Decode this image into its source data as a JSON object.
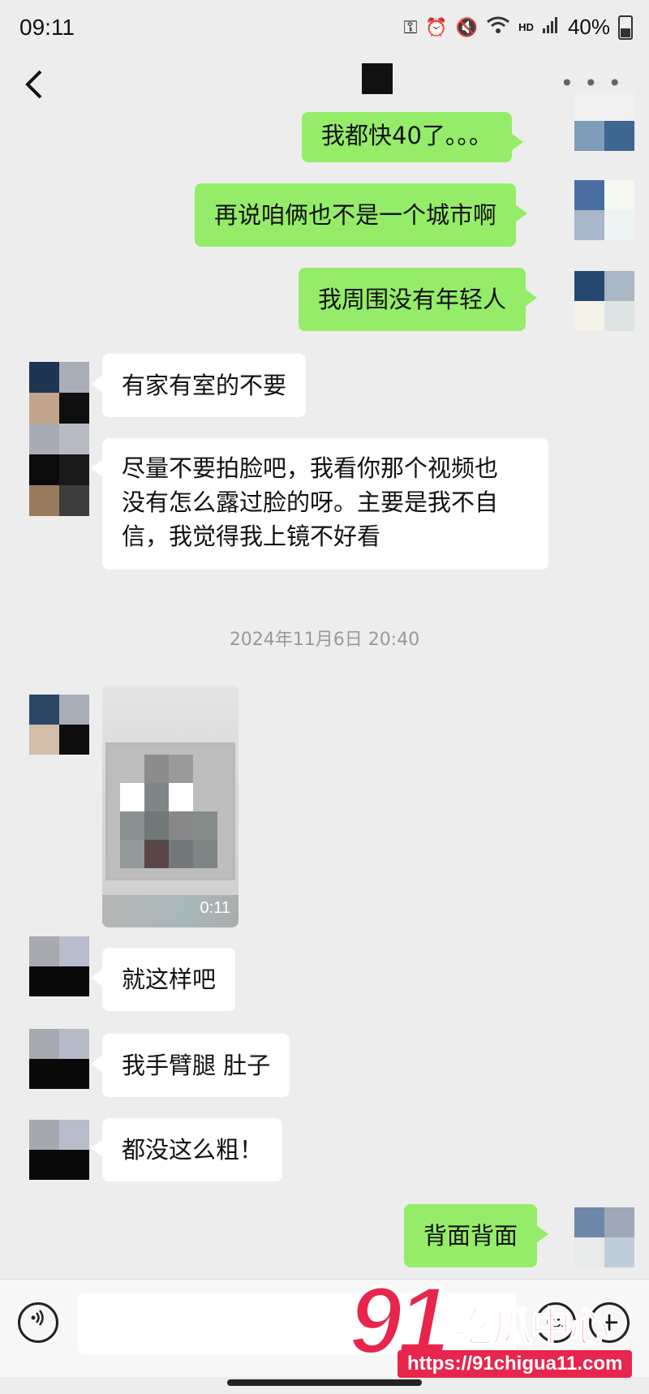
{
  "status_bar": {
    "time": "09:11",
    "hd_label": "HD",
    "battery": "40%"
  },
  "header": {
    "back_icon": "chevron-left-icon",
    "more_icon": "more-dots-icon"
  },
  "messages": [
    {
      "side": "me",
      "text": "我都快40了。。。"
    },
    {
      "side": "me",
      "text": "再说咱俩也不是一个城市啊"
    },
    {
      "side": "me",
      "text": "我周围没有年轻人"
    },
    {
      "side": "them",
      "text": "有家有室的不要"
    },
    {
      "side": "them",
      "text_lines": [
        "尽量不要拍脸吧，我看你那个视频也",
        "没有怎么露过脸的呀。主要是我不自",
        "信，我觉得我上镜不好看"
      ]
    },
    {
      "side": "them",
      "type": "video",
      "duration": "0:11"
    },
    {
      "side": "them",
      "text": "就这样吧"
    },
    {
      "side": "them",
      "text": "我手臂腿 肚子"
    },
    {
      "side": "them",
      "text": "都没这么粗！"
    },
    {
      "side": "me",
      "text": "背面背面"
    }
  ],
  "timestamp": "2024年11月6日 20:40",
  "input_bar": {
    "voice_icon": "voice-icon",
    "emoji_icon": "emoji-icon",
    "plus_icon": "plus-icon"
  },
  "watermark": {
    "number": "91",
    "text": "吃瓜中心",
    "url": "https://91chigua11.com"
  },
  "colors": {
    "my_bubble": "#95ec69",
    "their_bubble": "#ffffff",
    "background": "#ededed",
    "watermark": "#e8254c"
  }
}
